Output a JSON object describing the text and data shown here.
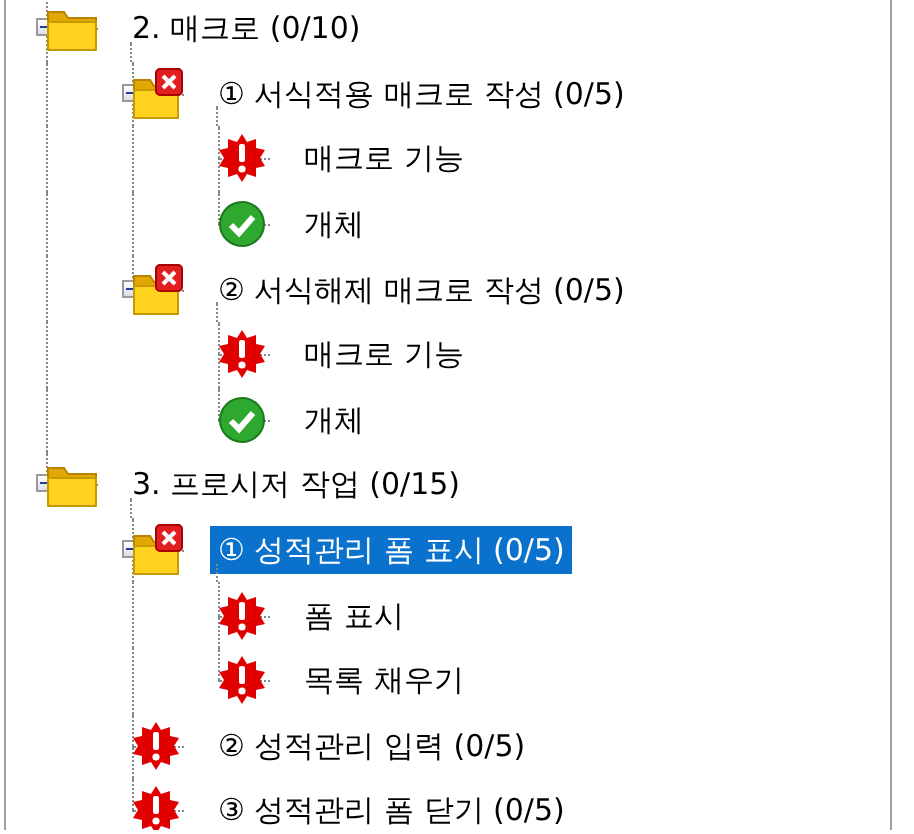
{
  "tree": [
    {
      "kind": "folder",
      "label": "2. 매크로 (0/10)",
      "expanded": true,
      "selected": false,
      "children": [
        {
          "kind": "folder_error",
          "label": "① 서식적용 매크로 작성 (0/5)",
          "expanded": true,
          "selected": false,
          "children": [
            {
              "kind": "error",
              "label": "매크로 기능",
              "selected": false
            },
            {
              "kind": "ok",
              "label": "개체",
              "selected": false
            }
          ]
        },
        {
          "kind": "folder_error",
          "label": "② 서식해제 매크로 작성 (0/5)",
          "expanded": true,
          "selected": false,
          "children": [
            {
              "kind": "error",
              "label": "매크로 기능",
              "selected": false
            },
            {
              "kind": "ok",
              "label": "개체",
              "selected": false
            }
          ]
        }
      ]
    },
    {
      "kind": "folder",
      "label": "3. 프로시저 작업 (0/15)",
      "expanded": true,
      "selected": false,
      "children": [
        {
          "kind": "folder_error",
          "label": "① 성적관리 폼 표시 (0/5)",
          "expanded": true,
          "selected": true,
          "children": [
            {
              "kind": "error",
              "label": "폼 표시",
              "selected": false
            },
            {
              "kind": "error",
              "label": "목록 채우기",
              "selected": false
            }
          ]
        },
        {
          "kind": "error",
          "label": "② 성적관리 입력 (0/5)",
          "selected": false
        },
        {
          "kind": "error",
          "label": "③ 성적관리 폼 닫기 (0/5)",
          "selected": false
        }
      ]
    }
  ]
}
